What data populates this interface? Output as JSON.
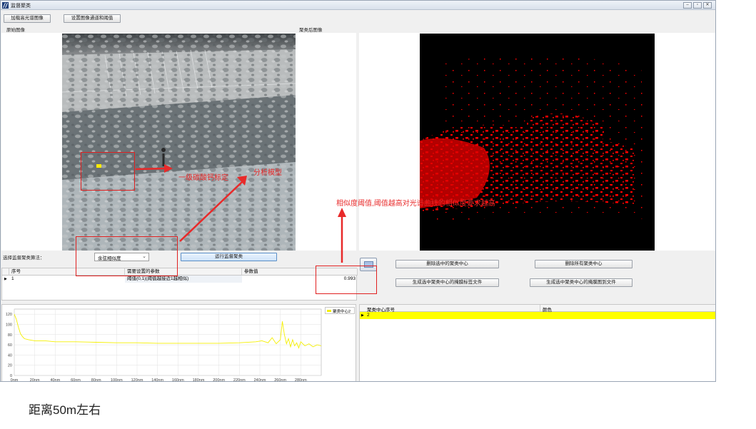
{
  "window": {
    "title": "监督聚类",
    "controls": [
      "–",
      "▫",
      "✕"
    ]
  },
  "toolbar": {
    "load_button": "加载高光谱图像",
    "threshold_button": "设置图像通道和阈值"
  },
  "left_panel": {
    "title": "原始图像"
  },
  "right_panel": {
    "title": "聚类后图像"
  },
  "algorithm": {
    "label": "选择监督聚类算法：",
    "selected": "余弦相似度",
    "run_button": "运行监督聚类"
  },
  "param_table": {
    "headers": [
      "序号",
      "需要设置的参数",
      "参数值"
    ],
    "rows": [
      {
        "index": "1",
        "param": "阈值(0,1)(阈值越接近1越相似)",
        "value": "0.993"
      }
    ]
  },
  "center_buttons": {
    "delete_selected": "删除选中的聚类中心",
    "delete_all": "删除所有聚类中心",
    "gen_label_file": "生成选中聚类中心的掩膜标签文件",
    "gen_mask_image": "生成选中聚类中心的掩膜图到文件"
  },
  "center_table": {
    "headers": [
      "聚类中心序号",
      "颜色"
    ],
    "rows": [
      {
        "index": "2",
        "color": "#ffff00"
      }
    ]
  },
  "chart_data": {
    "type": "line",
    "legend": "聚类中心2",
    "legend_position": "top-right",
    "x_ticks": [
      "0nm",
      "20nm",
      "40nm",
      "60nm",
      "80nm",
      "100nm",
      "120nm",
      "140nm",
      "160nm",
      "180nm",
      "200nm",
      "220nm",
      "240nm",
      "260nm",
      "280nm"
    ],
    "y_ticks": [
      "0",
      "20",
      "40",
      "60",
      "80",
      "100",
      "120"
    ],
    "xlim": [
      0,
      300
    ],
    "ylim": [
      0,
      130
    ],
    "grid": true,
    "series": [
      {
        "name": "聚类中心2",
        "color": "#f5f000",
        "x": [
          0,
          2,
          4,
          6,
          8,
          10,
          14,
          20,
          30,
          40,
          60,
          80,
          100,
          120,
          140,
          160,
          180,
          200,
          220,
          236,
          242,
          248,
          252,
          256,
          260,
          262,
          264,
          266,
          268,
          270,
          272,
          274,
          276,
          278,
          280,
          284,
          288,
          292,
          296,
          300
        ],
        "y": [
          120,
          110,
          95,
          82,
          76,
          72,
          70,
          68,
          68,
          66,
          66,
          65,
          64,
          64,
          63,
          63,
          63,
          63,
          64,
          66,
          68,
          64,
          74,
          62,
          70,
          106,
          80,
          62,
          72,
          56,
          70,
          58,
          64,
          54,
          66,
          58,
          62,
          56,
          60,
          58
        ]
      }
    ]
  },
  "annotations": {
    "calibrate": "一级碳酸钙标定",
    "model": "分析模型",
    "threshold_note": "相似度阈值,阈值越高对光谱曲线的相似度要求越高",
    "distance": "距离50m左右"
  }
}
